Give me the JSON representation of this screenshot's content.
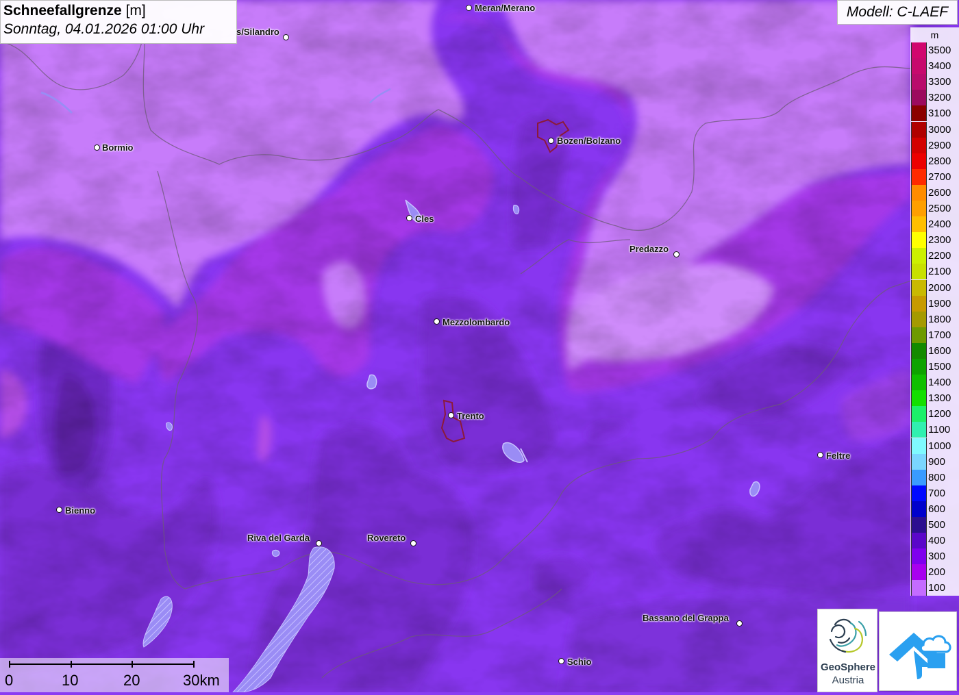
{
  "header": {
    "title": "Schneefallgrenze",
    "unit": "[m]",
    "datetime": "Sonntag, 04.01.2026 01:00 Uhr"
  },
  "model": "Modell: C-LAEF",
  "legend": {
    "unit": "m",
    "items": [
      {
        "label": "3500",
        "color": "#d1066e"
      },
      {
        "label": "3400",
        "color": "#c7096d"
      },
      {
        "label": "3300",
        "color": "#b90b6c"
      },
      {
        "label": "3200",
        "color": "#9c0a5e"
      },
      {
        "label": "3100",
        "color": "#8b0000"
      },
      {
        "label": "3000",
        "color": "#b00000"
      },
      {
        "label": "2900",
        "color": "#d30000"
      },
      {
        "label": "2800",
        "color": "#ec0000"
      },
      {
        "label": "2700",
        "color": "#ff2a00"
      },
      {
        "label": "2600",
        "color": "#ff8c00"
      },
      {
        "label": "2500",
        "color": "#ff9f00"
      },
      {
        "label": "2400",
        "color": "#ffbf00"
      },
      {
        "label": "2300",
        "color": "#ffff00"
      },
      {
        "label": "2200",
        "color": "#ccf000"
      },
      {
        "label": "2100",
        "color": "#c8e000"
      },
      {
        "label": "2000",
        "color": "#c9b900"
      },
      {
        "label": "1900",
        "color": "#c79a00"
      },
      {
        "label": "1800",
        "color": "#a59a00"
      },
      {
        "label": "1700",
        "color": "#6e9a00"
      },
      {
        "label": "1600",
        "color": "#138a00"
      },
      {
        "label": "1500",
        "color": "#0da300"
      },
      {
        "label": "1400",
        "color": "#0fbf00"
      },
      {
        "label": "1300",
        "color": "#13df00"
      },
      {
        "label": "1200",
        "color": "#1cf06a"
      },
      {
        "label": "1100",
        "color": "#30f0b0"
      },
      {
        "label": "1000",
        "color": "#7ffaff"
      },
      {
        "label": "900",
        "color": "#7ad6ff"
      },
      {
        "label": "800",
        "color": "#3a9bff"
      },
      {
        "label": "700",
        "color": "#0008ff"
      },
      {
        "label": "600",
        "color": "#0000cc"
      },
      {
        "label": "500",
        "color": "#2c0f90"
      },
      {
        "label": "400",
        "color": "#5a07c9"
      },
      {
        "label": "300",
        "color": "#7f00ee"
      },
      {
        "label": "200",
        "color": "#a800ef"
      },
      {
        "label": "100",
        "color": "#c46cff"
      }
    ]
  },
  "cities": [
    {
      "name": "Meran/Merano"
    },
    {
      "name": "s/Silandro"
    },
    {
      "name": "Bormio"
    },
    {
      "name": "Bozen/Bolzano"
    },
    {
      "name": "Cles"
    },
    {
      "name": "Predazzo"
    },
    {
      "name": "Mezzolombardo"
    },
    {
      "name": "Trento"
    },
    {
      "name": "Feltre"
    },
    {
      "name": "Bienno"
    },
    {
      "name": "Riva del Garda"
    },
    {
      "name": "Rovereto"
    },
    {
      "name": "Bassano del Grappa"
    },
    {
      "name": "Schio"
    }
  ],
  "scalebar": {
    "labels": [
      "0",
      "10",
      "20",
      "30km"
    ]
  },
  "logos": {
    "geosphere_name": "GeoSphere",
    "geosphere_sub": "Austria"
  }
}
